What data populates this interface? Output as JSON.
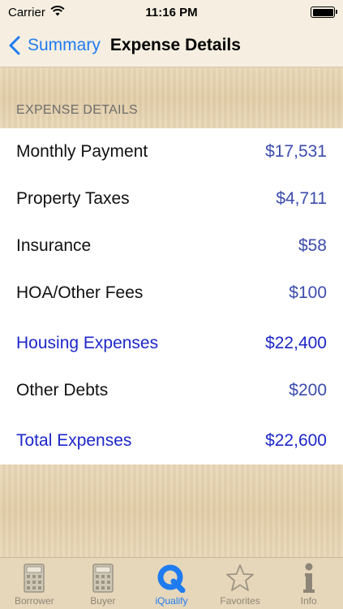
{
  "status_bar": {
    "carrier": "Carrier",
    "time": "11:16 PM"
  },
  "nav": {
    "back_label": "Summary",
    "title": "Expense Details"
  },
  "section": {
    "header": "EXPENSE DETAILS"
  },
  "rows": [
    {
      "label": "Monthly Payment",
      "value": "$17,531"
    },
    {
      "label": "Property Taxes",
      "value": "$4,711"
    },
    {
      "label": "Insurance",
      "value": "$58"
    },
    {
      "label": "HOA/Other Fees",
      "value": "$100"
    },
    {
      "label": "Housing Expenses",
      "value": "$22,400"
    },
    {
      "label": "Other Debts",
      "value": "$200"
    },
    {
      "label": "Total Expenses",
      "value": "$22,600"
    }
  ],
  "tabs": [
    {
      "label": "Borrower",
      "icon": "calculator-icon"
    },
    {
      "label": "Buyer",
      "icon": "calculator-icon"
    },
    {
      "label": "iQualify",
      "icon": "iqualify-q-icon"
    },
    {
      "label": "Favorites",
      "icon": "star-icon"
    },
    {
      "label": "Info",
      "icon": "info-icon"
    }
  ],
  "colors": {
    "accent": "#1f7bf0",
    "value_text": "#3b4cac",
    "total_text": "#1d27c8",
    "tab_inactive": "#8d8577"
  },
  "active_tab": "iQualify"
}
